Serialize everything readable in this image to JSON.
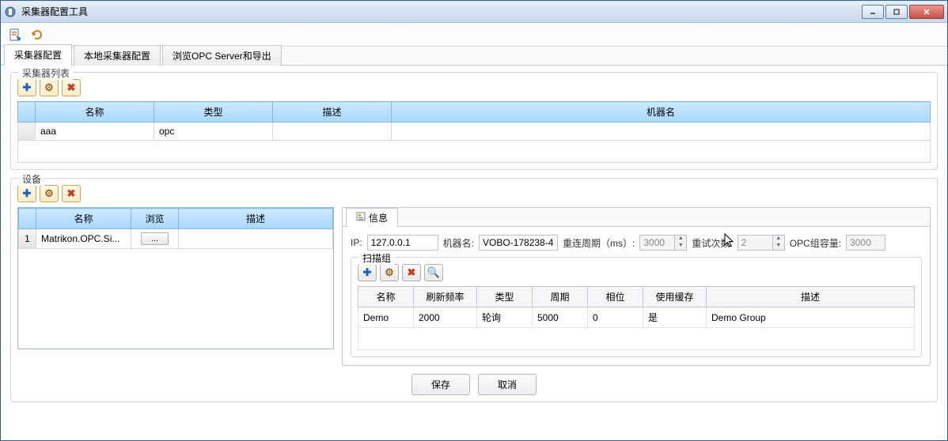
{
  "window": {
    "title": "采集器配置工具"
  },
  "tabs": {
    "t1": "采集器配置",
    "t2": "本地采集器配置",
    "t3": "浏览OPC Server和导出"
  },
  "collector": {
    "group_title": "采集器列表",
    "headers": {
      "name": "名称",
      "type": "类型",
      "desc": "描述",
      "machine": "机器名"
    },
    "row": {
      "name": "aaa",
      "type": "opc",
      "desc": "",
      "machine": ""
    }
  },
  "device": {
    "group_title": "设备",
    "headers": {
      "name": "名称",
      "browse": "浏览",
      "desc": "描述"
    },
    "row": {
      "idx": "1",
      "name": "Matrikon.OPC.Si...",
      "browse": "...",
      "desc": ""
    }
  },
  "info": {
    "tab_label": "信息",
    "ip_label": "IP:",
    "ip_value": "127.0.0.1",
    "machine_label": "机器名:",
    "machine_value": "VOBO-178238-4",
    "reconnect_label": "重连周期（ms）:",
    "reconnect_value": "3000",
    "retry_label": "重试次数:",
    "retry_value": "2",
    "opc_label": "OPC组容量:",
    "opc_value": "3000"
  },
  "scan": {
    "title": "扫描组",
    "headers": {
      "name": "名称",
      "refresh": "刷新频率",
      "type": "类型",
      "period": "周期",
      "phase": "相位",
      "cache": "使用缓存",
      "desc": "描述"
    },
    "row": {
      "name": "Demo",
      "refresh": "2000",
      "type": "轮询",
      "period": "5000",
      "phase": "0",
      "cache": "是",
      "desc": "Demo Group"
    }
  },
  "footer": {
    "save": "保存",
    "cancel": "取消"
  }
}
